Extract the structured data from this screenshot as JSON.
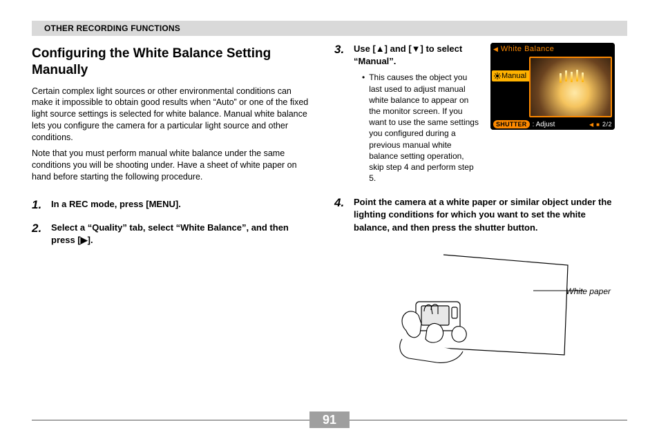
{
  "section_header": "OTHER RECORDING FUNCTIONS",
  "title": "Configuring the White Balance Setting Manually",
  "para1": "Certain complex light sources or other environmental conditions can make it impossible to obtain good results when “Auto” or one of the fixed light source settings is selected for white balance. Manual white balance lets you configure the camera for a particular light source and other conditions.",
  "para2": "Note that you must perform manual white balance under the same conditions you will be shooting under. Have a sheet of white paper on hand before starting the following procedure.",
  "steps": {
    "s1": {
      "num": "1.",
      "text": "In a REC mode, press [MENU]."
    },
    "s2": {
      "num": "2.",
      "text": "Select a “Quality” tab, select “White Balance”, and then press [▶]."
    },
    "s3": {
      "num": "3.",
      "text": "Use [▲] and [▼] to select “Manual”.",
      "sub": "This causes the object you last used to adjust manual white balance to appear on the monitor screen. If you want to use the same settings you configured during a previous manual white balance setting operation, skip step 4 and perform step 5."
    },
    "s4": {
      "num": "4.",
      "text": "Point the camera at a white paper or similar object under the lighting conditions for which you want to set the white balance, and then press the shutter button."
    }
  },
  "lcd": {
    "top_title": "White Balance",
    "selected": "Manual",
    "bottom_pill": "SHUTTER",
    "bottom_text": ": Adjust",
    "page_indicator": "2/2"
  },
  "illustration_label": "White paper",
  "page_number": "91"
}
